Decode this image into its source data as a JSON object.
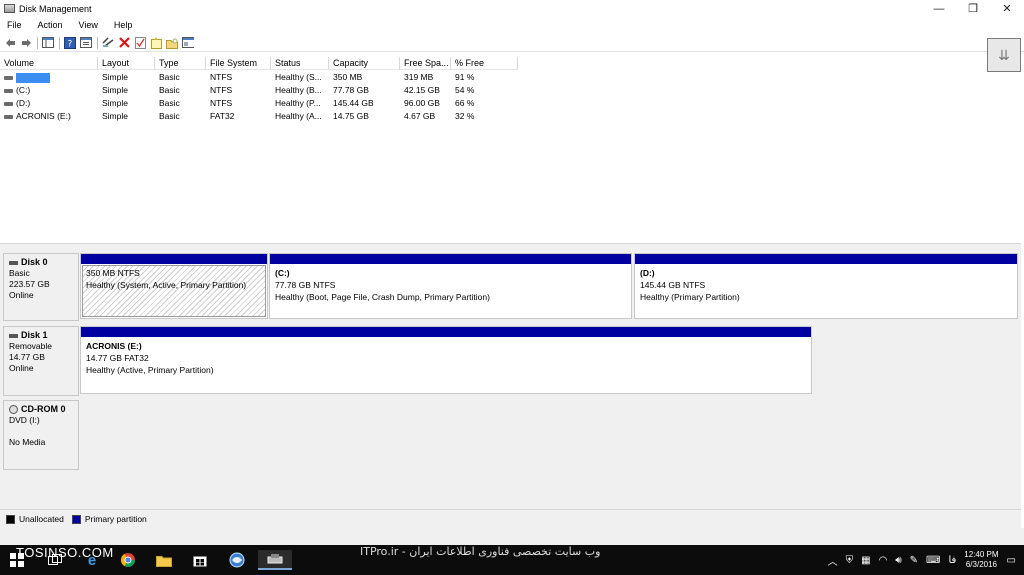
{
  "window": {
    "title": "Disk Management",
    "controls": {
      "minimize": "—",
      "restore": "❐",
      "close": "✕"
    }
  },
  "menu": [
    "File",
    "Action",
    "View",
    "Help"
  ],
  "toolbar": {
    "icons": [
      "back-icon",
      "forward-icon",
      "show-hide-icon",
      "help-icon",
      "properties-icon",
      "connect-icon",
      "delete-icon",
      "check-icon",
      "new-icon",
      "open-icon",
      "console-icon"
    ]
  },
  "volume_list": {
    "columns": [
      "Volume",
      "Layout",
      "Type",
      "File System",
      "Status",
      "Capacity",
      "Free Spa...",
      "% Free"
    ],
    "rows": [
      {
        "volume": "",
        "layout": "Simple",
        "type": "Basic",
        "fs": "NTFS",
        "status": "Healthy (S...",
        "capacity": "350 MB",
        "free": "319 MB",
        "pct": "91 %"
      },
      {
        "volume": "(C:)",
        "layout": "Simple",
        "type": "Basic",
        "fs": "NTFS",
        "status": "Healthy (B...",
        "capacity": "77.78 GB",
        "free": "42.15 GB",
        "pct": "54 %"
      },
      {
        "volume": "(D:)",
        "layout": "Simple",
        "type": "Basic",
        "fs": "NTFS",
        "status": "Healthy (P...",
        "capacity": "145.44 GB",
        "free": "96.00 GB",
        "pct": "66 %"
      },
      {
        "volume": "ACRONIS (E:)",
        "layout": "Simple",
        "type": "Basic",
        "fs": "FAT32",
        "status": "Healthy (A...",
        "capacity": "14.75 GB",
        "free": "4.67 GB",
        "pct": "32 %"
      }
    ]
  },
  "disks": [
    {
      "name": "Disk 0",
      "kind": "Basic",
      "size": "223.57 GB",
      "state": "Online",
      "partitions": [
        {
          "label": "",
          "size": "350 MB NTFS",
          "status": "Healthy (System, Active, Primary Partition)"
        },
        {
          "label": "(C:)",
          "size": "77.78 GB NTFS",
          "status": "Healthy (Boot, Page File, Crash Dump, Primary Partition)"
        },
        {
          "label": "(D:)",
          "size": "145.44 GB NTFS",
          "status": "Healthy (Primary Partition)"
        }
      ]
    },
    {
      "name": "Disk 1",
      "kind": "Removable",
      "size": "14.77 GB",
      "state": "Online",
      "partitions": [
        {
          "label": "ACRONIS  (E:)",
          "size": "14.77 GB FAT32",
          "status": "Healthy (Active, Primary Partition)"
        }
      ]
    },
    {
      "name": "CD-ROM 0",
      "kind": "DVD (I:)",
      "size": "",
      "state": "No Media",
      "partitions": []
    }
  ],
  "legend": {
    "unallocated": "Unallocated",
    "primary": "Primary partition",
    "colors": {
      "unallocated": "#000000",
      "primary": "#0000a0"
    }
  },
  "taskbar": {
    "watermark_left": "TOSINSO.COM",
    "watermark_right": "ITPro.ir - وب سایت تخصصی فناوری اطلاعات ایران",
    "lang": "فا",
    "time": "12:40 PM",
    "date": "6/3/2016"
  }
}
